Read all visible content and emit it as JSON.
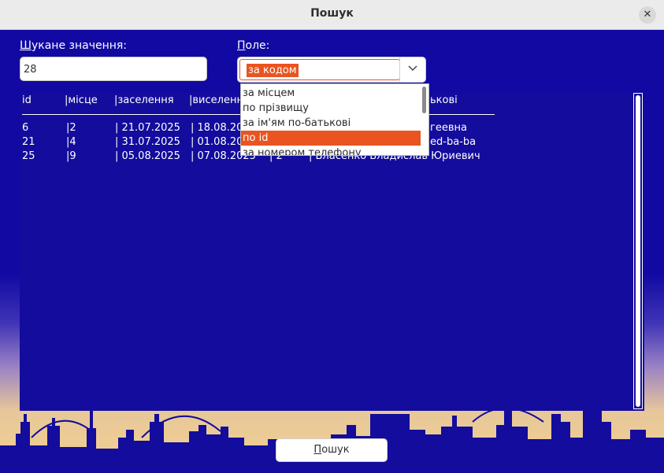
{
  "window": {
    "title": "Пошук",
    "close_icon": "close-icon"
  },
  "search": {
    "label": "Шукане значення:",
    "label_first": "Ш",
    "label_rest": "укане значення:",
    "value": "28"
  },
  "field": {
    "label": "Поле:",
    "label_first": "П",
    "label_rest": "оле:",
    "selected": "за кодом"
  },
  "table": {
    "columns": [
      "id",
      "|місце",
      "|заселення",
      "|виселення",
      "ькові"
    ],
    "rows": [
      [
        "6",
        "|2",
        "| 21.07.2025",
        "| 18.08.20",
        "геевна"
      ],
      [
        "21",
        "|4",
        "| 31.07.2025",
        "| 01.08.20",
        "ed-ba-ba"
      ],
      [
        "25",
        "|9",
        "| 05.08.2025",
        "| 07.08.2025",
        "| 2",
        "| Власенко Владислав Юриевич"
      ]
    ]
  },
  "dropdown": {
    "options": [
      "за місцем",
      "по прізвищу",
      "за ім'ям по-батькові",
      "по id",
      "за номером телефону"
    ],
    "selected_index": 3
  },
  "search_button": {
    "label": "Пошук",
    "label_first": "П",
    "label_rest": "ошук"
  },
  "colors": {
    "background": "#130c9c",
    "accent": "#e95420",
    "text": "#ffffff"
  }
}
